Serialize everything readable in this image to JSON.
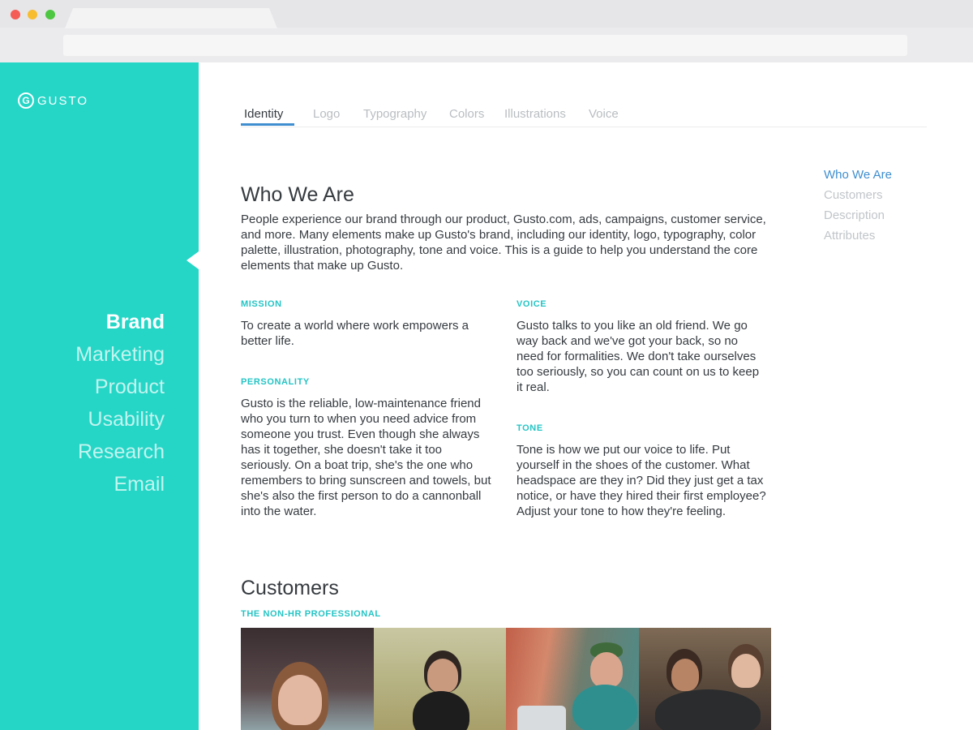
{
  "sidebar": {
    "logo_mark": "G",
    "logo_text": "GUSTO",
    "nav": [
      "Brand",
      "Marketing",
      "Product",
      "Usability",
      "Research",
      "Email"
    ]
  },
  "tabs": [
    "Identity",
    "Logo",
    "Typography",
    "Colors",
    "Illustrations",
    "Voice"
  ],
  "toc": [
    "Who We Are",
    "Customers",
    "Description",
    "Attributes"
  ],
  "who_we_are": {
    "title": "Who We Are",
    "intro": "People experience our brand through our product, Gusto.com, ads, campaigns, customer service, and more. Many elements make up Gusto's brand, including our identity, logo, typography, color palette, illustration, photography, tone and voice. This is a guide to help you understand the core elements that make up Gusto.",
    "mission_label": "MISSION",
    "mission_text": "To create a world where work empowers a better life.",
    "personality_label": "PERSONALITY",
    "personality_text": "Gusto is the reliable, low-maintenance friend who you turn to when you need advice from someone you trust. Even though she always has it together, she doesn't take it too seriously. On a boat trip, she's the one who remembers to bring sunscreen and towels, but she's also the first person to do a cannonball into the water.",
    "voice_label": "VOICE",
    "voice_text": "Gusto talks to you like an old friend. We go way back and we've got your back, so no need for formalities. We don't take ourselves too seriously, so you can count on us to keep it real.",
    "tone_label": "TONE",
    "tone_text": "Tone is how we put our voice to life. Put yourself in the shoes of the customer. What headspace are they in? Did they just get a tax notice, or have they hired their first employee? Adjust your tone to how they're feeling."
  },
  "customers": {
    "title": "Customers",
    "subtitle": "THE NON-HR PROFESSIONAL"
  },
  "colors": {
    "sidebar": "#25d6c7",
    "accent_blue": "#3f8ecf",
    "label_teal": "#25c4c5",
    "text": "#363b40"
  }
}
